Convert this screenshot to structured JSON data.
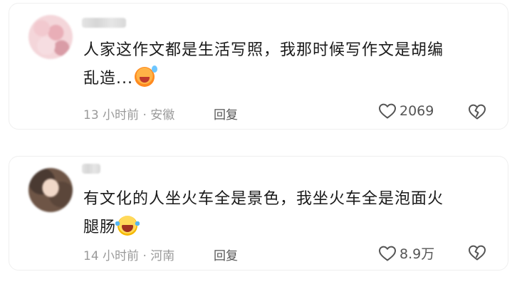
{
  "comments": [
    {
      "content_line1": "人家这作文都是生活写照，我那时候写作文是胡编",
      "content_line2": "乱造...",
      "emoji": "sweat-smile-emoji",
      "meta": "13 小时前 · 安徽",
      "reply_label": "回复",
      "likes": "2069"
    },
    {
      "content_line1": "有文化的人坐火车全是景色，我坐火车全是泡面火",
      "content_line2": "腿肠",
      "emoji": "laughing-tears-emoji",
      "meta": "14 小时前 · 河南",
      "reply_label": "回复",
      "likes": "8.9万"
    }
  ],
  "colors": {
    "text_primary": "#1a1a1a",
    "text_secondary": "#9a9a9a",
    "action_text": "#555555",
    "card_border": "#efefef"
  },
  "icons": {
    "like": "heart-outline-icon",
    "dislike": "broken-heart-icon"
  }
}
